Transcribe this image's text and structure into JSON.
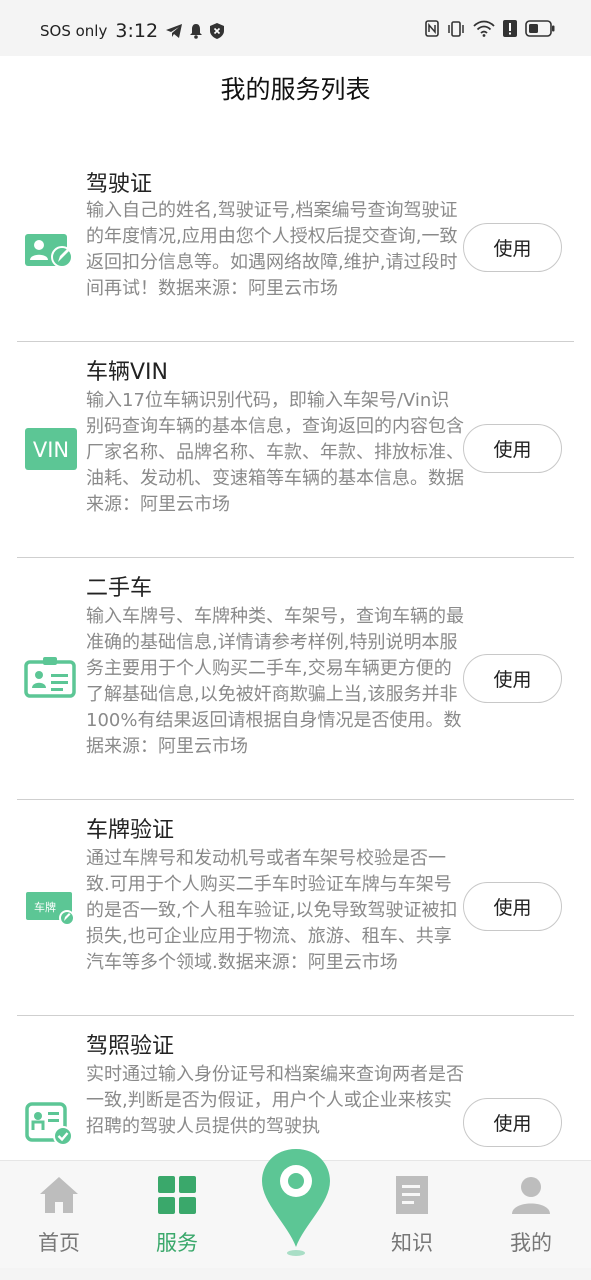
{
  "status_bar": {
    "carrier": "SOS only",
    "time": "3:12"
  },
  "header": {
    "title": "我的服务列表"
  },
  "colors": {
    "accent": "#3aa86b",
    "icon_green": "#5cc695",
    "text_gray": "#8a8a8a"
  },
  "services": [
    {
      "name": "驾驶证",
      "icon": "driver-license-icon",
      "description": "输入自己的姓名,驾驶证号,档案编号查询驾驶证的年度情况,应用由您个人授权后提交查询,一致返回扣分信息等。如遇网络故障,维护,请过段时间再试！数据来源：阿里云市场",
      "button": "使用"
    },
    {
      "name": "车辆VIN",
      "icon": "vin-icon",
      "icon_text": "VIN",
      "description": "输入17位车辆识别代码，即输入车架号/Vin识别码查询车辆的基本信息，查询返回的内容包含厂家名称、品牌名称、车款、年款、排放标准、油耗、发动机、变速箱等车辆的基本信息。数据来源：阿里云市场",
      "button": "使用"
    },
    {
      "name": "二手车",
      "icon": "id-card-icon",
      "description": "输入车牌号、车牌种类、车架号，查询车辆的最准确的基础信息,详情请参考样例,特别说明本服务主要用于个人购买二手车,交易车辆更方便的了解基础信息,以免被奸商欺骗上当,该服务并非100%有结果返回请根据自身情况是否使用。数据来源：阿里云市场",
      "button": "使用"
    },
    {
      "name": "车牌验证",
      "icon": "license-plate-icon",
      "icon_text": "车牌",
      "description": "通过车牌号和发动机号或者车架号校验是否一致.可用于个人购买二手车时验证车牌与车架号的是否一致,个人租车验证,以免导致驾驶证被扣损失,也可企业应用于物流、旅游、租车、共享汽车等多个领域.数据来源：阿里云市场",
      "button": "使用"
    },
    {
      "name": "驾照验证",
      "icon": "license-verify-icon",
      "description": "实时通过输入身份证号和档案编来查询两者是否一致,判断是否为假证，用户个人或企业来核实招聘的驾驶人员提供的驾驶执",
      "button": "使用"
    }
  ],
  "tabbar": {
    "items": [
      {
        "label": "首页",
        "icon": "home-icon",
        "active": false
      },
      {
        "label": "服务",
        "icon": "grid-icon",
        "active": true
      },
      {
        "label": "",
        "icon": "location-pin-icon",
        "active": false
      },
      {
        "label": "知识",
        "icon": "document-icon",
        "active": false
      },
      {
        "label": "我的",
        "icon": "user-icon",
        "active": false
      }
    ]
  }
}
